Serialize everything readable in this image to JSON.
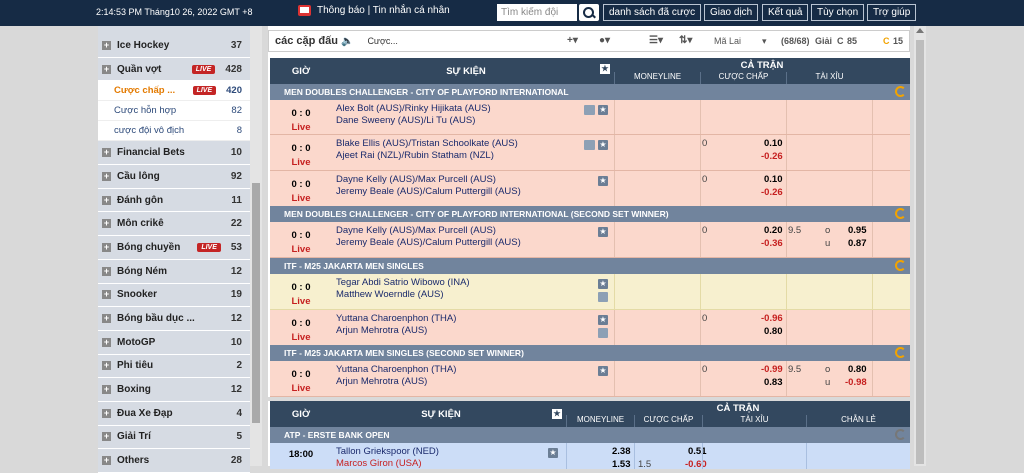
{
  "topbar": {
    "time": "2:14:53 PM Tháng10 26, 2022 GMT +8",
    "notif": "Thông báo | Tin nhắn cá nhân",
    "search_placeholder": "Tìm kiếm đội",
    "nav": [
      "danh sách đã cược",
      "Giao dịch",
      "Kết quả",
      "Tùy chọn",
      "Trợ giúp"
    ]
  },
  "sidebar": {
    "items": [
      {
        "name": "Ice Hockey",
        "count": "37"
      },
      {
        "name": "Quần vợt",
        "count": "428",
        "live": "LIVE"
      }
    ],
    "subs": [
      {
        "name": "Cược chấp ...",
        "count": "420",
        "live": "LIVE"
      },
      {
        "name": "Cược hỗn hợp",
        "count": "82"
      },
      {
        "name": "cược đội vô địch",
        "count": "8"
      }
    ],
    "items2": [
      {
        "name": "Financial Bets",
        "count": "10"
      },
      {
        "name": "Cầu lông",
        "count": "92"
      },
      {
        "name": "Đánh gôn",
        "count": "11"
      },
      {
        "name": "Môn crikê",
        "count": "22"
      },
      {
        "name": "Bóng chuyền",
        "count": "53",
        "live": "LIVE"
      },
      {
        "name": "Bóng Ném",
        "count": "12"
      },
      {
        "name": "Snooker",
        "count": "19"
      },
      {
        "name": "Bóng bầu dục ...",
        "count": "12"
      },
      {
        "name": "MotoGP",
        "count": "10"
      },
      {
        "name": "Phi tiêu",
        "count": "2"
      },
      {
        "name": "Boxing",
        "count": "12"
      },
      {
        "name": "Đua Xe Đạp",
        "count": "4"
      },
      {
        "name": "Giải Trí",
        "count": "5"
      },
      {
        "name": "Others",
        "count": "28"
      }
    ]
  },
  "filter": {
    "label": "các cặp đấu",
    "cuoc": "Cược...",
    "lang": "Mã Lai",
    "count": "(68/68)",
    "giai": "Giải",
    "c85": "85",
    "c15": "15"
  },
  "header": {
    "gio": "GIỜ",
    "sukien": "SỰ KIỆN",
    "catran": "CẢ TRẬN",
    "moneyline": "MONEYLINE",
    "cuocchap": "CƯỢC CHẤP",
    "taixiu": "TÀI XỈU",
    "chanle": "CHẴN LẺ"
  },
  "leagues": {
    "l1": "MEN DOUBLES CHALLENGER - CITY OF PLAYFORD INTERNATIONAL",
    "l2": "MEN DOUBLES CHALLENGER - CITY OF PLAYFORD INTERNATIONAL (SECOND SET WINNER)",
    "l3": "ITF - M25 JAKARTA MEN SINGLES",
    "l4": "ITF - M25 JAKARTA MEN SINGLES (SECOND SET WINNER)",
    "l5": "ATP - ERSTE BANK OPEN"
  },
  "rows": {
    "r1": {
      "score": "0 : 0",
      "live": "Live",
      "t1": "Alex Bolt (AUS)/Rinky Hijikata (AUS)",
      "t2": "Dane Sweeny (AUS)/Li Tu (AUS)"
    },
    "r2": {
      "score": "0 : 0",
      "live": "Live",
      "t1": "Blake Ellis (AUS)/Tristan Schoolkate (AUS)",
      "t2": "Ajeet Rai (NZL)/Rubin Statham (NZL)",
      "h": "0",
      "o1": "0.10",
      "o2": "-0.26"
    },
    "r3": {
      "score": "0 : 0",
      "live": "Live",
      "t1": "Dayne Kelly (AUS)/Max Purcell (AUS)",
      "t2": "Jeremy Beale (AUS)/Calum Puttergill (AUS)",
      "h": "0",
      "o1": "0.10",
      "o2": "-0.26"
    },
    "r4": {
      "score": "0 : 0",
      "live": "Live",
      "t1": "Dayne Kelly (AUS)/Max Purcell (AUS)",
      "t2": "Jeremy Beale (AUS)/Calum Puttergill (AUS)",
      "h": "0",
      "o1": "0.20",
      "o2": "-0.36",
      "ou": "9.5",
      "ou_o": "o",
      "ou_u": "u",
      "ou1": "0.95",
      "ou2": "0.87"
    },
    "r5": {
      "score": "0 : 0",
      "live": "Live",
      "t1": "Tegar Abdi Satrio Wibowo (INA)",
      "t2": "Matthew Woerndle (AUS)"
    },
    "r6": {
      "score": "0 : 0",
      "live": "Live",
      "t1": "Yuttana Charoenphon (THA)",
      "t2": "Arjun Mehrotra (AUS)",
      "h": "0",
      "o1": "-0.96",
      "o2": "0.80"
    },
    "r7": {
      "score": "0 : 0",
      "live": "Live",
      "t1": "Yuttana Charoenphon (THA)",
      "t2": "Arjun Mehrotra (AUS)",
      "h": "0",
      "o1": "-0.99",
      "o2": "0.83",
      "ou": "9.5",
      "ou_o": "o",
      "ou_u": "u",
      "ou1": "0.80",
      "ou2": "-0.98"
    },
    "r8": {
      "time": "18:00",
      "t1": "Tallon Griekspoor (NED)",
      "t2": "Marcos Giron (USA)",
      "m1": "2.38",
      "m2": "1.53",
      "h": "1.5",
      "o1": "0.51",
      "o2": "-0.60"
    }
  }
}
